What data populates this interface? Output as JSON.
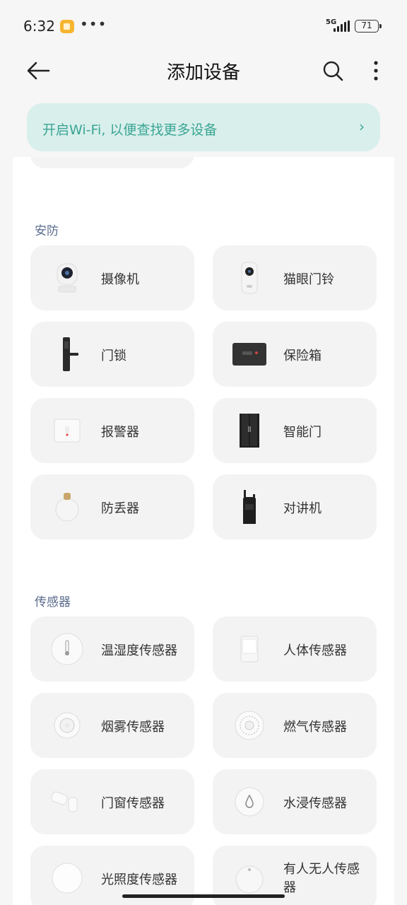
{
  "status": {
    "time": "6:32",
    "network": "5G",
    "battery": "71"
  },
  "header": {
    "title": "添加设备"
  },
  "wifi_banner": {
    "text": "开启Wi-Fi, 以便查找更多设备",
    "chevron": "›"
  },
  "sections": [
    {
      "title": "安防",
      "items": [
        {
          "label": "摄像机",
          "icon": "camera-icon"
        },
        {
          "label": "猫眼门铃",
          "icon": "doorbell-icon"
        },
        {
          "label": "门锁",
          "icon": "door-lock-icon"
        },
        {
          "label": "保险箱",
          "icon": "safe-icon"
        },
        {
          "label": "报警器",
          "icon": "alarm-icon"
        },
        {
          "label": "智能门",
          "icon": "smart-door-icon"
        },
        {
          "label": "防丢器",
          "icon": "tracker-icon"
        },
        {
          "label": "对讲机",
          "icon": "walkie-talkie-icon"
        }
      ]
    },
    {
      "title": "传感器",
      "items": [
        {
          "label": "温湿度传感器",
          "icon": "thermometer-sensor-icon"
        },
        {
          "label": "人体传感器",
          "icon": "motion-sensor-icon"
        },
        {
          "label": "烟雾传感器",
          "icon": "smoke-sensor-icon"
        },
        {
          "label": "燃气传感器",
          "icon": "gas-sensor-icon"
        },
        {
          "label": "门窗传感器",
          "icon": "door-window-sensor-icon"
        },
        {
          "label": "水浸传感器",
          "icon": "water-leak-sensor-icon"
        },
        {
          "label": "光照度传感器",
          "icon": "light-sensor-icon"
        },
        {
          "label": "有人无人传感器",
          "icon": "presence-sensor-icon"
        }
      ]
    }
  ],
  "colors": {
    "accent": "#3aa593",
    "banner_bg": "#d9efec",
    "section_title": "#5a6b8c",
    "card_bg": "#f3f3f3"
  }
}
